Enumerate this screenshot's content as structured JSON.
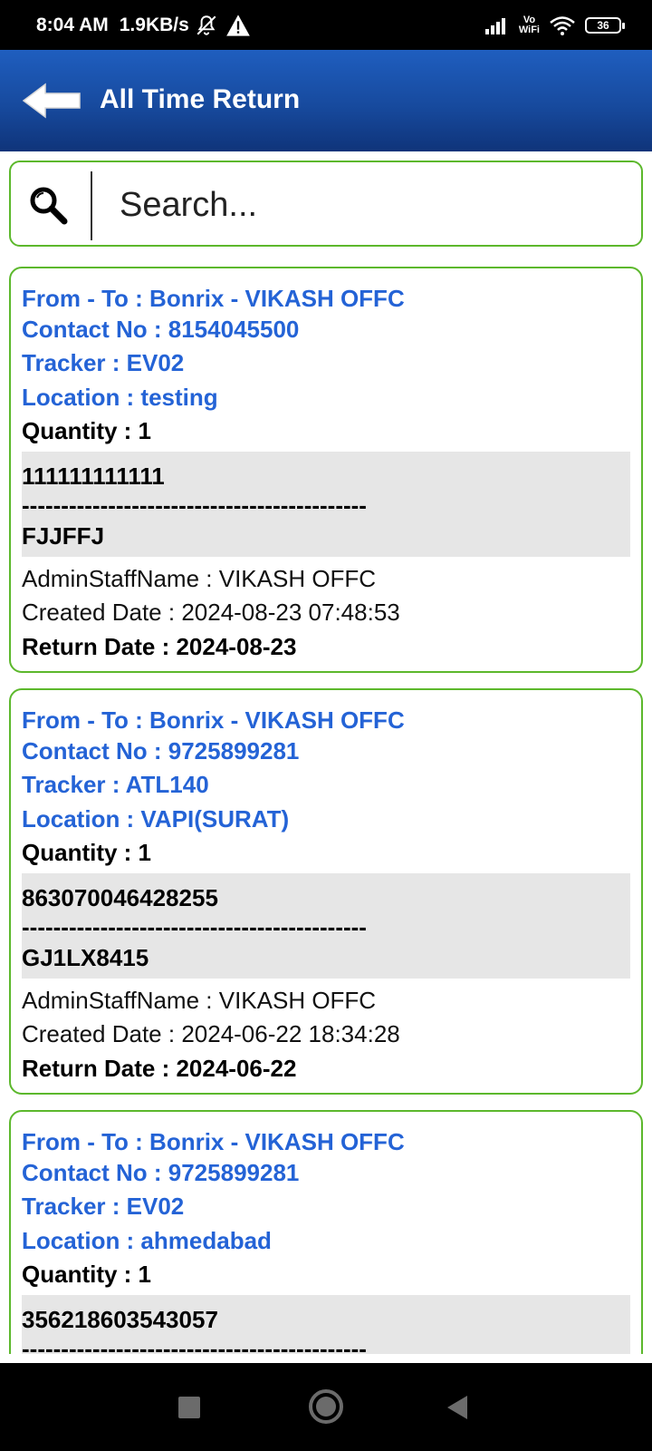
{
  "status_bar": {
    "time": "8:04 AM",
    "speed": "1.9KB/s",
    "icons": [
      "mute-bell-icon",
      "warning-icon",
      "signal-icon",
      "vowifi-icon",
      "wifi-icon",
      "battery-icon"
    ],
    "vowifi_top": "Vo",
    "vowifi_bottom": "WiFi",
    "battery": "36"
  },
  "header": {
    "title": "All Time Return",
    "back_icon": "back-arrow-icon",
    "color": "#174a9e"
  },
  "search": {
    "placeholder": "Search...",
    "icon": "search-icon",
    "border_color": "#5cb82c"
  },
  "records": [
    {
      "from_to": "From - To : Bonrix - VIKASH OFFC",
      "contact": "Contact No : 8154045500",
      "tracker": "Tracker : EV02",
      "location": "Location : testing",
      "quantity": "Quantity : 1",
      "code": "111111111111",
      "separator": "--------------------------------------------",
      "vehicle": "FJJFFJ",
      "admin": "AdminStaffName : VIKASH OFFC",
      "created": "Created Date : 2024-08-23 07:48:53",
      "return": "Return Date : 2024-08-23"
    },
    {
      "from_to": "From - To : Bonrix - VIKASH OFFC",
      "contact": "Contact No : 9725899281",
      "tracker": "Tracker : ATL140",
      "location": "Location : VAPI(SURAT)",
      "quantity": "Quantity : 1",
      "code": "863070046428255",
      "separator": "--------------------------------------------",
      "vehicle": "GJ1LX8415",
      "admin": "AdminStaffName : VIKASH OFFC",
      "created": "Created Date : 2024-06-22 18:34:28",
      "return": "Return Date : 2024-06-22"
    },
    {
      "from_to": "From - To : Bonrix - VIKASH OFFC",
      "contact": "Contact No : 9725899281",
      "tracker": "Tracker : EV02",
      "location": "Location : ahmedabad",
      "quantity": "Quantity : 1",
      "code": "356218603543057",
      "separator": "--------------------------------------------",
      "vehicle": "",
      "admin": "",
      "created": "",
      "return": ""
    }
  ],
  "nav_bar": {
    "buttons": [
      "recents-square-icon",
      "home-circle-icon",
      "back-triangle-icon"
    ]
  }
}
